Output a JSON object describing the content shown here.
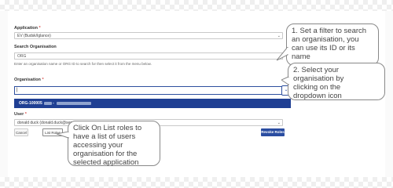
{
  "form": {
    "application": {
      "label": "Application",
      "required_mark": "*",
      "value": "EV (Budsk/Iglance)"
    },
    "search_organisation": {
      "label": "Search Organisation",
      "value": "ORG",
      "help": "Enter an organisation name or ORG ID to search for then select it from the menu below."
    },
    "organisation": {
      "label": "Organisation",
      "required_mark": "*",
      "value": "|",
      "dropdown_option_prefix": "ORG-100005",
      "dropdown_option_sep": " - "
    },
    "user": {
      "label": "User",
      "required_mark": "*",
      "value": "donald duck (donald.duck@sergelsewill.com)"
    },
    "buttons": {
      "cancel": "Cancel",
      "list_roles": "List Roles",
      "revoke_roles": "Revoke Roles"
    }
  },
  "callouts": {
    "filter": [
      "1. Set a filter to search",
      "an organisation, you",
      "can use its ID or its",
      "name"
    ],
    "select": [
      "2. Select your",
      "organisation by",
      "clicking on the",
      "dropdown icon"
    ],
    "list_roles": [
      "Click On List roles to",
      "have a list of users",
      "accessing your",
      "organisation for the",
      "selected application"
    ]
  },
  "colors": {
    "accent": "#1f3f93",
    "required": "#d9534f",
    "callout_border": "#888888"
  },
  "icons": {
    "dropdown": "chevron-down-icon"
  }
}
